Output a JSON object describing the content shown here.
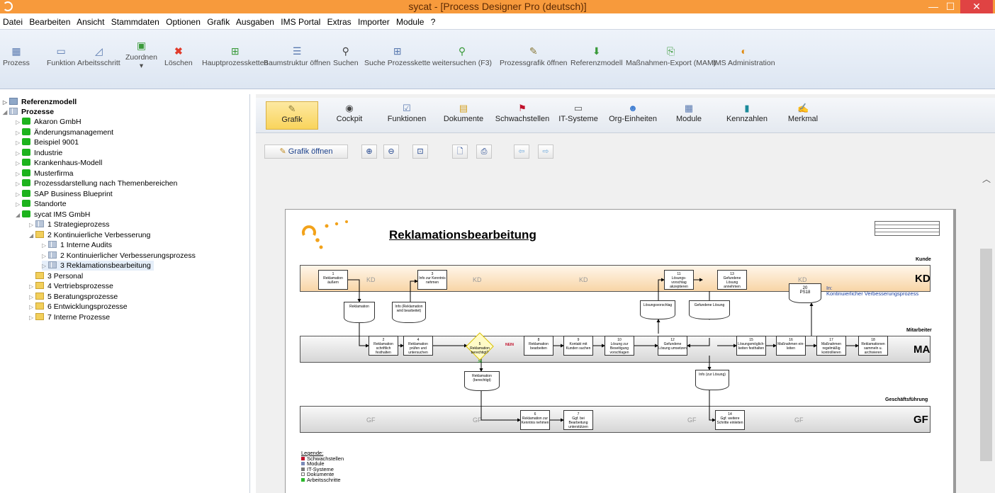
{
  "window": {
    "title": "sycat - [Process Designer Pro (deutsch)]",
    "controls": {
      "minimize": "—",
      "maximize": "☐",
      "close": "✕"
    }
  },
  "menu": [
    "Datei",
    "Bearbeiten",
    "Ansicht",
    "Stammdaten",
    "Optionen",
    "Grafik",
    "Ausgaben",
    "IMS Portal",
    "Extras",
    "Importer",
    "Module",
    "?"
  ],
  "toolbar": [
    {
      "label": "Prozess",
      "icon": "process-icon"
    },
    {
      "label": "Funktion",
      "icon": "function-icon"
    },
    {
      "label": "Arbeitsschritt",
      "icon": "step-icon"
    },
    {
      "label": "Zuordnen",
      "icon": "assign-icon"
    },
    {
      "label": "Löschen",
      "icon": "delete-icon"
    },
    {
      "label": "Hauptprozessketten",
      "icon": "main-chain-icon"
    },
    {
      "label": "Baumstruktur öffnen",
      "icon": "tree-icon"
    },
    {
      "label": "Suchen",
      "icon": "search-icon"
    },
    {
      "label": "Suche Prozesskette",
      "icon": "search-chain-icon"
    },
    {
      "label": "weitersuchen (F3)",
      "icon": "search-next-icon"
    },
    {
      "label": "Prozessgrafik öffnen",
      "icon": "graphic-icon"
    },
    {
      "label": "Referenzmodell",
      "icon": "reference-icon"
    },
    {
      "label": "Maßnahmen-Export (MAM)",
      "icon": "export-icon"
    },
    {
      "label": "IMS Administration",
      "icon": "admin-icon"
    }
  ],
  "tree": [
    {
      "label": "Referenzmodell",
      "bold": true
    },
    {
      "label": "Prozesse",
      "bold": true
    },
    {
      "label": "Akaron GmbH"
    },
    {
      "label": "Änderungsmanagement"
    },
    {
      "label": "Beispiel 9001"
    },
    {
      "label": "Industrie"
    },
    {
      "label": "Krankenhaus-Modell"
    },
    {
      "label": "Musterfirma"
    },
    {
      "label": "Prozessdarstellung nach Themenbereichen"
    },
    {
      "label": "SAP Business Blueprint"
    },
    {
      "label": "Standorte"
    },
    {
      "label": "sycat IMS GmbH"
    },
    {
      "label": "1  Strategieprozess"
    },
    {
      "label": "2  Kontinuierliche Verbesserung"
    },
    {
      "label": "1  Interne Audits"
    },
    {
      "label": "2  Kontinuierlicher Verbesserungsprozess"
    },
    {
      "label": "3  Reklamationsbearbeitung",
      "selected": true
    },
    {
      "label": "3  Personal"
    },
    {
      "label": "4  Vertriebsprozesse"
    },
    {
      "label": "5  Beratungsprozesse"
    },
    {
      "label": "6  Entwicklungsprozesse"
    },
    {
      "label": "7  Interne Prozesse"
    }
  ],
  "tabs": [
    {
      "label": "Grafik",
      "icon": "graphic-icon",
      "active": true
    },
    {
      "label": "Cockpit",
      "icon": "cockpit-icon"
    },
    {
      "label": "Funktionen",
      "icon": "functions-icon"
    },
    {
      "label": "Dokumente",
      "icon": "documents-icon"
    },
    {
      "label": "Schwachstellen",
      "icon": "flag-icon"
    },
    {
      "label": "IT-Systeme",
      "icon": "computer-icon"
    },
    {
      "label": "Org-Einheiten",
      "icon": "people-icon"
    },
    {
      "label": "Module",
      "icon": "module-icon"
    },
    {
      "label": "Kennzahlen",
      "icon": "bar-chart-icon"
    },
    {
      "label": "Merkmal",
      "icon": "feature-icon"
    }
  ],
  "subtoolbar": {
    "open_graphic": "Grafik öffnen"
  },
  "diagram": {
    "title": "Reklamationsbearbeitung",
    "lanes": [
      {
        "name": "Kunde",
        "abbr": "KD"
      },
      {
        "name": "Mitarbeiter",
        "abbr": "MA"
      },
      {
        "name": "Geschäftsführung",
        "abbr": "GF"
      }
    ],
    "steps": [
      {
        "num": "1",
        "text": "Reklamation äußern"
      },
      {
        "num": "3",
        "text": "Info zur Kenntnis nehmen"
      },
      {
        "num": "11",
        "text": "Lösungs-vorschlag akzeptieren"
      },
      {
        "num": "13",
        "text": "Gefundene Lösung annehmen"
      },
      {
        "num": "2",
        "text": "Reklamation schriftlich festhalten"
      },
      {
        "num": "4",
        "text": "Reklamation prüfen und untersuchen"
      },
      {
        "num": "5",
        "text": "Reklamation berechtigt?"
      },
      {
        "num": "8",
        "text": "Reklamation bearbeiten"
      },
      {
        "num": "9",
        "text": "Kontakt mit Kunden suchen"
      },
      {
        "num": "10",
        "text": "Lösung zur Beseitigung vorschlagen"
      },
      {
        "num": "12",
        "text": "Gefundene Lösung umsetzen"
      },
      {
        "num": "15",
        "text": "Lösungsmöglich-keiten festhalten"
      },
      {
        "num": "16",
        "text": "Maßnahmen ein-leiten"
      },
      {
        "num": "17",
        "text": "Maßnahmen regelmäßig kontrollieren"
      },
      {
        "num": "18",
        "text": "Reklamationen sammeln u. archivieren"
      },
      {
        "num": "6",
        "text": "Reklamation zur Kenntnis nehmen"
      },
      {
        "num": "7",
        "text": "Ggf. bei Bearbeitung unterstützen"
      },
      {
        "num": "14",
        "text": "Ggf. weitere Schritte einleiten"
      }
    ],
    "documents": [
      "Reklamation",
      "Info (Reklamation wird bearbeitet)",
      "Lösungsvorschlag",
      "Gefundene Lösung",
      "Reklamation (berechtigt)",
      "Info (zur Lösung)"
    ],
    "ps_ref": {
      "num": "20",
      "code": "PS18",
      "prefix": "In:",
      "name": "Kontinuierlicher Verbesserungsprozess"
    },
    "decision_no": "NEIN",
    "decision_yes": "JA",
    "legend": {
      "title": "Legende:",
      "items": [
        "Schwachstellen",
        "Module",
        "IT-Systeme",
        "Dokumente",
        "Arbeitsschritte"
      ]
    }
  }
}
